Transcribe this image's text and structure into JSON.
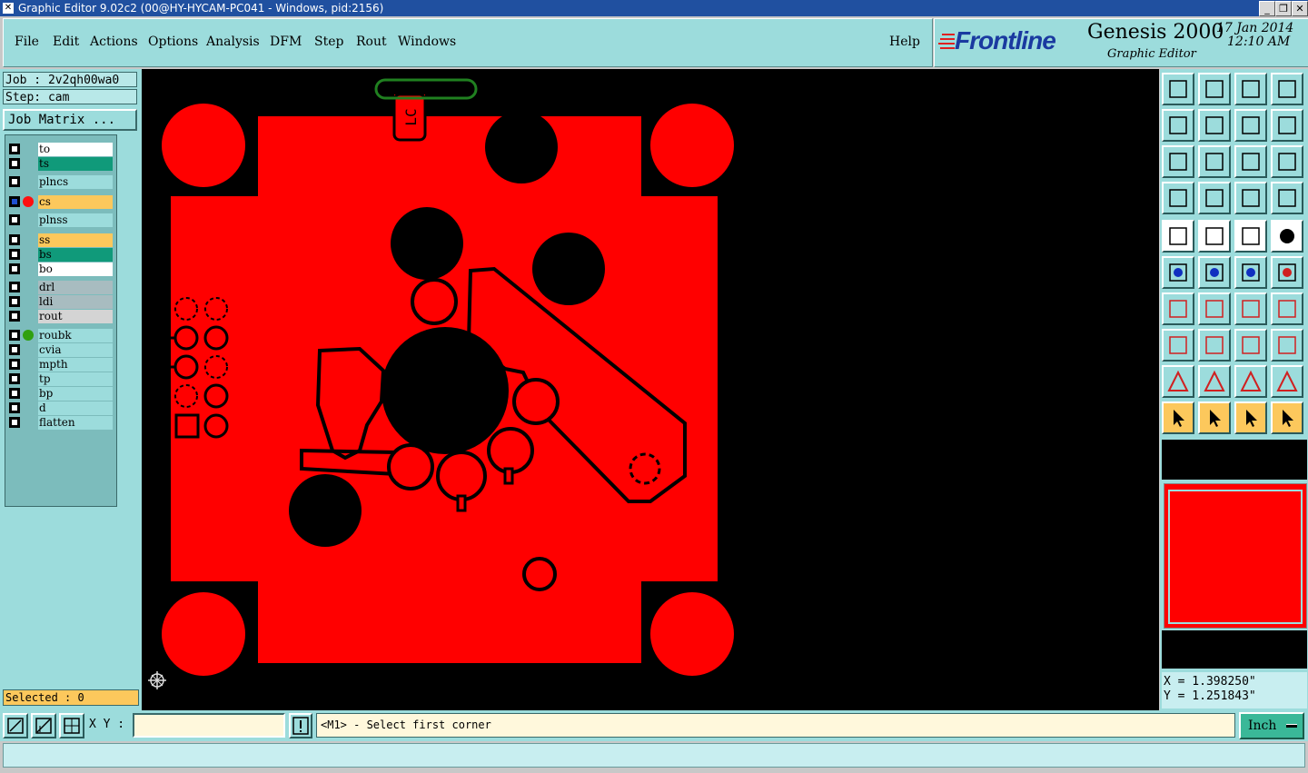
{
  "window": {
    "title": "Graphic Editor 9.02c2 (00@HY-HYCAM-PC041 - Windows, pid:2156)",
    "controls": [
      "_",
      "❐",
      "✕"
    ]
  },
  "menu": {
    "items": [
      "File",
      "Edit",
      "Actions",
      "Options",
      "Analysis",
      "DFM",
      "Step",
      "Rout",
      "Windows"
    ],
    "help": "Help"
  },
  "brand": {
    "logo": "Frontline",
    "product": "Genesis 2000",
    "subtitle": "Graphic Editor",
    "date": "17 Jan 2014",
    "time": "12:10 AM"
  },
  "job": {
    "job_label": "Job : 2v2qh00wa0",
    "step_label": "Step: cam",
    "matrix_button": "Job Matrix ..."
  },
  "layers": [
    {
      "name": "to",
      "bg": "#ffffff"
    },
    {
      "name": "ts",
      "bg": "#109a7a"
    },
    {
      "name": "plncs",
      "bg": "#9cdcdc"
    },
    {
      "name": "cs",
      "bg": "#fcc85c",
      "active": true,
      "dot": "#ff1010"
    },
    {
      "name": "plnss",
      "bg": "#9cdcdc"
    },
    {
      "name": "ss",
      "bg": "#fcc85c"
    },
    {
      "name": "bs",
      "bg": "#109a7a"
    },
    {
      "name": "bo",
      "bg": "#ffffff"
    },
    {
      "name": "drl",
      "bg": "#a8bcc0"
    },
    {
      "name": "ldi",
      "bg": "#a8bcc0"
    },
    {
      "name": "rout",
      "bg": "#d4d4d4"
    },
    {
      "name": "roubk",
      "bg": "#9cdcdc",
      "dot": "#30a010"
    },
    {
      "name": "cvia",
      "bg": "#9cdcdc"
    },
    {
      "name": "mpth",
      "bg": "#9cdcdc"
    },
    {
      "name": "tp",
      "bg": "#9cdcdc"
    },
    {
      "name": "bp",
      "bg": "#9cdcdc"
    },
    {
      "name": "d",
      "bg": "#9cdcdc"
    },
    {
      "name": "flatten",
      "bg": "#9cdcdc"
    }
  ],
  "selected": "Selected : 0",
  "canvas": {
    "silk_text": "LC",
    "copper_color": "#ff0000",
    "background_color": "#000000"
  },
  "coords": {
    "x": "X = 1.398250\"",
    "y": "Y = 1.251843\""
  },
  "bottom": {
    "xy_label": "X Y :",
    "xy_value": "",
    "prompt": "<M1> - Select first corner",
    "unit": "Inch"
  }
}
